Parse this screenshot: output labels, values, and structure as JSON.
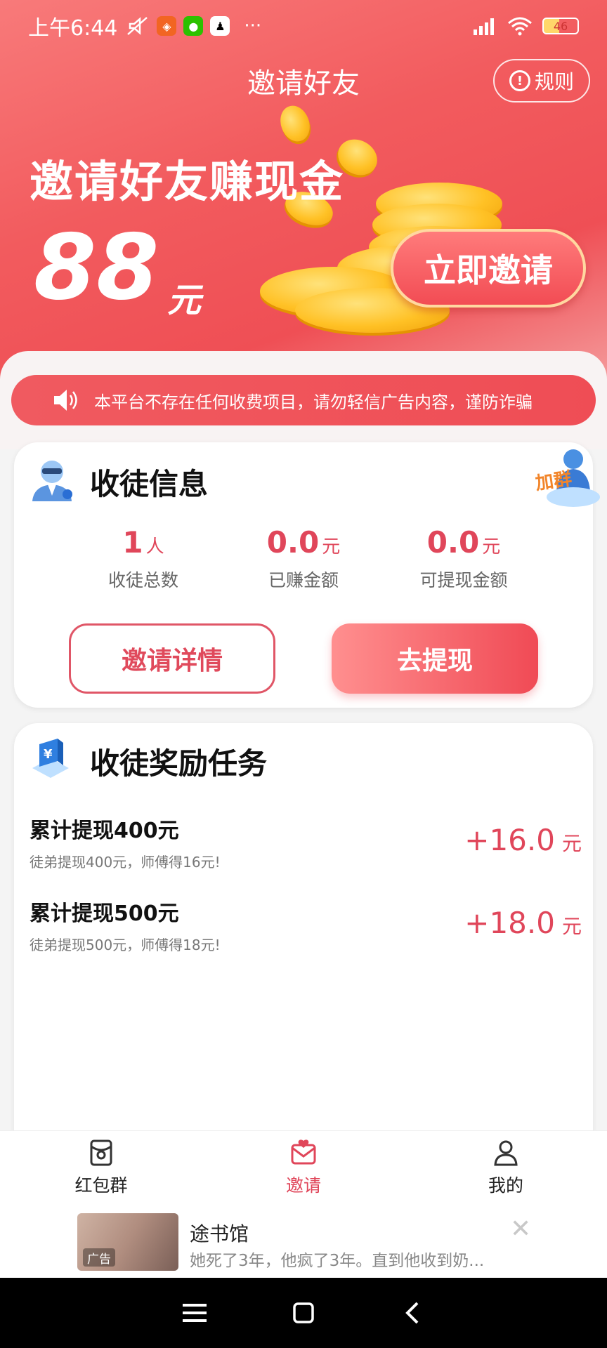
{
  "status_bar": {
    "time": "上午6:44",
    "more": "···",
    "battery": "46"
  },
  "header": {
    "title": "邀请好友",
    "rules_label": "规则"
  },
  "hero": {
    "headline": "邀请好友赚现金",
    "amount": "88",
    "unit": "元",
    "invite_button": "立即邀请"
  },
  "notice": {
    "text": "本平台不存在任何收费项目，请勿轻信广告内容，谨防诈骗"
  },
  "disciple_info": {
    "title": "收徒信息",
    "join_group_badge": "加群",
    "stats": [
      {
        "value": "1",
        "unit": "人",
        "label": "收徒总数"
      },
      {
        "value": "0.0",
        "unit": "元",
        "label": "已赚金额"
      },
      {
        "value": "0.0",
        "unit": "元",
        "label": "可提现金额"
      }
    ],
    "details_button": "邀请详情",
    "withdraw_button": "去提现"
  },
  "tasks": {
    "title": "收徒奖励任务",
    "items": [
      {
        "title": "累计提现400元",
        "desc": "徒弟提现400元，师傅得16元!",
        "reward": "+16.0",
        "unit": "元"
      },
      {
        "title": "累计提现500元",
        "desc": "徒弟提现500元，师傅得18元!",
        "reward": "+18.0",
        "unit": "元"
      }
    ]
  },
  "bottom_nav": {
    "items": [
      {
        "label": "红包群",
        "icon": "red-envelope-icon",
        "active": false
      },
      {
        "label": "邀请",
        "icon": "invite-envelope-icon",
        "active": true
      },
      {
        "label": "我的",
        "icon": "person-icon",
        "active": false
      }
    ]
  },
  "ad": {
    "tag": "广告",
    "title": "途书馆",
    "desc": "她死了3年，他疯了3年。直到他收到奶..."
  },
  "colors": {
    "accent": "#e0465a",
    "hero_red": "#f25b5e",
    "gold": "#ffc125"
  }
}
